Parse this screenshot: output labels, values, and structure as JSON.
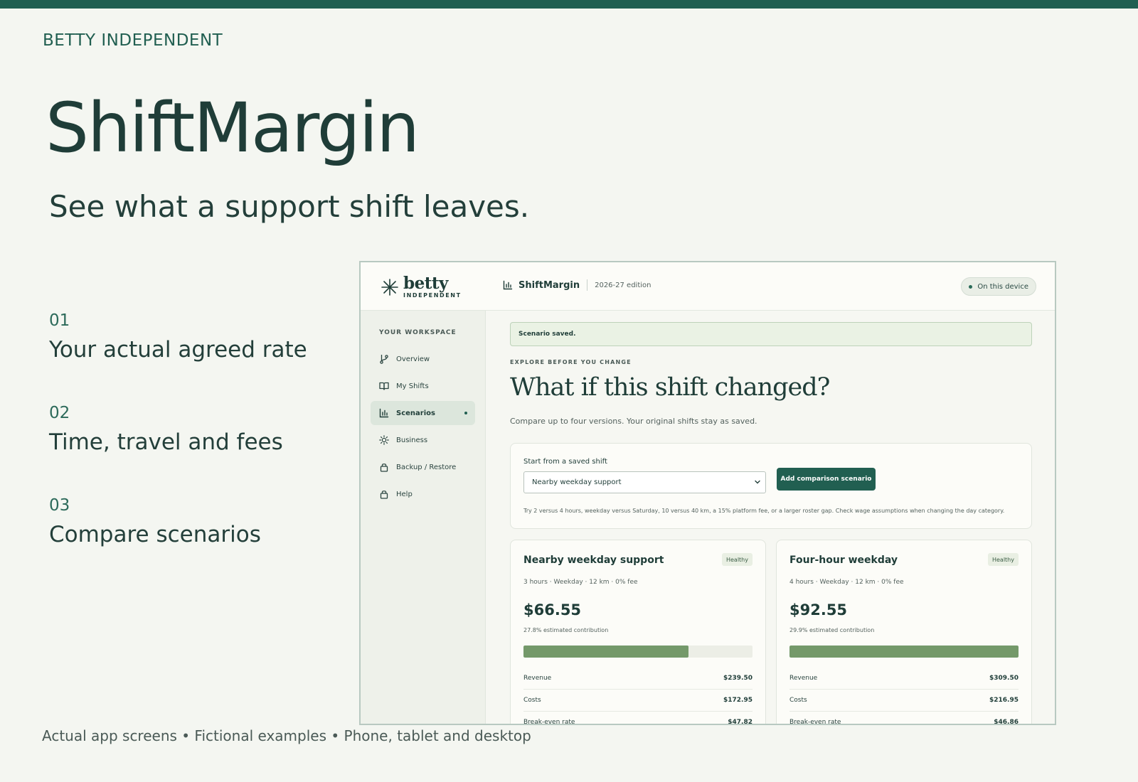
{
  "promo": {
    "brand": "BETTY INDEPENDENT",
    "title": "ShiftMargin",
    "subtitle": "See what a support shift leaves.",
    "features": [
      {
        "num": "01",
        "text": "Your actual agreed rate"
      },
      {
        "num": "02",
        "text": "Time, travel and fees"
      },
      {
        "num": "03",
        "text": "Compare scenarios"
      }
    ],
    "footer": "Actual app screens • Fictional examples • Phone, tablet and desktop"
  },
  "app": {
    "logo": {
      "main": "betty",
      "sub": "INDEPENDENT"
    },
    "header": {
      "app_name": "ShiftMargin",
      "edition": "2026-27 edition",
      "device_badge": "On this device"
    },
    "sidebar": {
      "heading": "YOUR WORKSPACE",
      "items": [
        {
          "label": "Overview",
          "icon": "branch-icon"
        },
        {
          "label": "My Shifts",
          "icon": "book-icon"
        },
        {
          "label": "Scenarios",
          "icon": "chart-icon",
          "active": true
        },
        {
          "label": "Business",
          "icon": "sun-icon"
        },
        {
          "label": "Backup / Restore",
          "icon": "lock-icon"
        },
        {
          "label": "Help",
          "icon": "lock-icon"
        }
      ]
    },
    "main": {
      "toast": "Scenario saved.",
      "eyebrow": "EXPLORE BEFORE YOU CHANGE",
      "title": "What if this shift changed?",
      "description": "Compare up to four versions. Your original shifts stay as saved.",
      "start": {
        "label": "Start from a saved shift",
        "selected": "Nearby weekday support",
        "button": "Add comparison scenario",
        "hint": "Try 2 versus 4 hours, weekday versus Saturday, 10 versus 40 km, a 15% platform fee, or a larger roster gap. Check wage assumptions when changing the day category."
      },
      "scenarios": [
        {
          "title": "Nearby weekday support",
          "badge": "Healthy",
          "meta": "3 hours · Weekday · 12 km · 0% fee",
          "amount": "$66.55",
          "contribution": "27.8% estimated contribution",
          "bar_fraction": 0.72,
          "rows": [
            {
              "label": "Revenue",
              "value": "$239.50"
            },
            {
              "label": "Costs",
              "value": "$172.95"
            },
            {
              "label": "Break-even rate",
              "value": "$47.82"
            }
          ]
        },
        {
          "title": "Four-hour weekday",
          "badge": "Healthy",
          "meta": "4 hours · Weekday · 12 km · 0% fee",
          "amount": "$92.55",
          "contribution": "29.9% estimated contribution",
          "bar_fraction": 1.0,
          "rows": [
            {
              "label": "Revenue",
              "value": "$309.50"
            },
            {
              "label": "Costs",
              "value": "$216.95"
            },
            {
              "label": "Break-even rate",
              "value": "$46.86"
            }
          ]
        }
      ]
    }
  }
}
